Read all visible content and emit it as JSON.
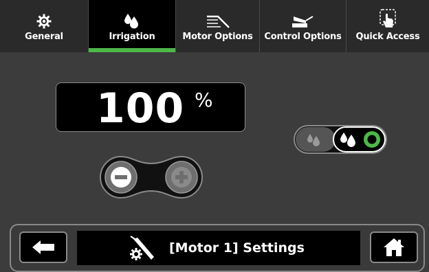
{
  "tabs": [
    {
      "label": "General",
      "icon": "gear-icon",
      "active": false
    },
    {
      "label": "Irrigation",
      "icon": "water-drops-icon",
      "active": true
    },
    {
      "label": "Motor Options",
      "icon": "handpiece-icon",
      "active": false
    },
    {
      "label": "Control Options",
      "icon": "foot-pedal-icon",
      "active": false
    },
    {
      "label": "Quick Access",
      "icon": "touch-hand-icon",
      "active": false
    }
  ],
  "irrigation": {
    "value": "100",
    "unit": "%",
    "flow_toggle_selected": "high"
  },
  "footer": {
    "title": "[Motor 1] Settings",
    "back_icon": "back-arrow-icon",
    "home_icon": "home-icon"
  },
  "colors": {
    "accent": "#4cb848",
    "background": "#3c3c3c"
  }
}
